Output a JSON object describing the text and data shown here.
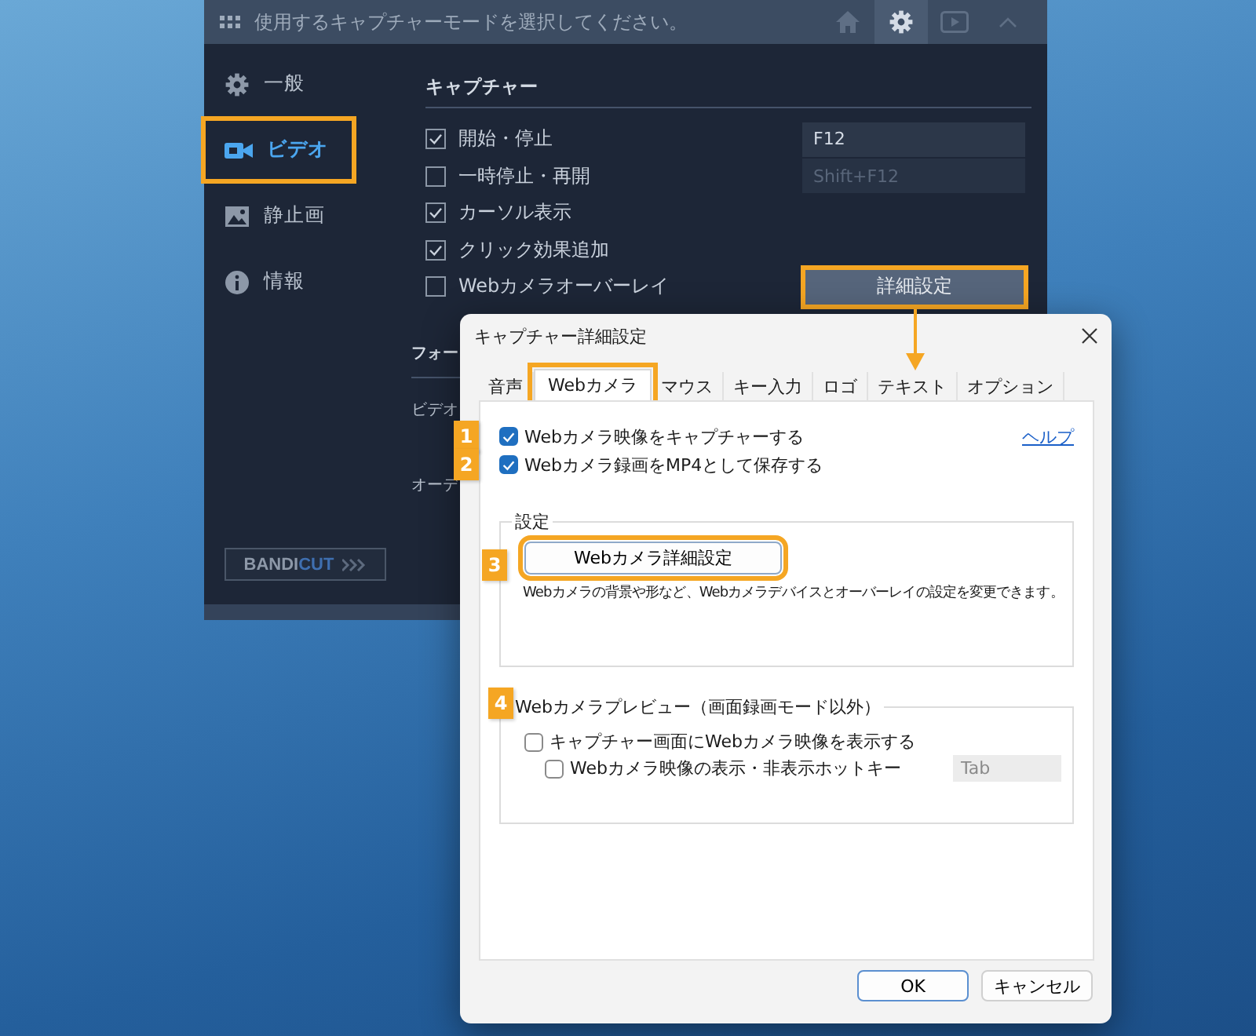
{
  "main_window": {
    "header_text": "使用するキャプチャーモードを選択してください。",
    "toolbar": [
      {
        "kind": "home",
        "selected": false
      },
      {
        "kind": "settings",
        "selected": true
      },
      {
        "kind": "video",
        "selected": false
      },
      {
        "kind": "collapse",
        "selected": false
      }
    ],
    "sidebar": {
      "items": [
        {
          "label": "一般",
          "kind": "gear",
          "selected": false,
          "highlighted": false
        },
        {
          "label": "ビデオ",
          "kind": "camera",
          "selected": true,
          "highlighted": true
        },
        {
          "label": "静止画",
          "kind": "image",
          "selected": false,
          "highlighted": false
        },
        {
          "label": "情報",
          "kind": "info",
          "selected": false,
          "highlighted": false
        }
      ]
    },
    "capture": {
      "heading": "キャプチャー",
      "options": [
        {
          "label": "開始・停止",
          "checked": true,
          "hotkey": "F12",
          "hotkey_disabled": false
        },
        {
          "label": "一時停止・再開",
          "checked": false,
          "hotkey": "Shift+F12",
          "hotkey_disabled": true
        },
        {
          "label": "カーソル表示",
          "checked": true
        },
        {
          "label": "クリック効果追加",
          "checked": true
        },
        {
          "label": "Webカメラオーバーレイ",
          "checked": false
        }
      ],
      "button": {
        "label": "詳細設定",
        "highlighted": true
      }
    },
    "section_2": {
      "heading": "フォー",
      "rows": [
        "ビデオ",
        "オーデ"
      ]
    },
    "bandicut_button": {
      "text": "BANDI",
      "accent_text": "CUT"
    }
  },
  "dialog": {
    "title": "キャプチャー詳細設定",
    "tabs": [
      {
        "label": "音声",
        "selected": false,
        "highlighted": false
      },
      {
        "label": "Webカメラ",
        "selected": true,
        "highlighted": true
      },
      {
        "label": "マウス",
        "selected": false,
        "highlighted": false
      },
      {
        "label": "キー入力",
        "selected": false,
        "highlighted": false
      },
      {
        "label": "ロゴ",
        "selected": false,
        "highlighted": false
      },
      {
        "label": "テキスト",
        "selected": false,
        "highlighted": false
      },
      {
        "label": "オプション",
        "selected": false,
        "highlighted": false
      }
    ],
    "options": [
      {
        "badge": "1",
        "label": "Webカメラ映像をキャプチャーする",
        "checked": true
      },
      {
        "badge": "2",
        "label": "Webカメラ録画をMP4として保存する",
        "checked": true
      }
    ],
    "help_link": "ヘルプ",
    "settings_group": {
      "title": "設定",
      "badge": "3",
      "button": {
        "label": "Webカメラ詳細設定",
        "highlighted": true
      },
      "description": "Webカメラの背景や形など、Webカメラデバイスとオーバーレイの設定を変更できます。"
    },
    "preview_group": {
      "badge": "4",
      "title": "Webカメラプレビュー（画面録画モード以外）",
      "options": [
        {
          "label": "キャプチャー画面にWebカメラ映像を表示する",
          "checked": false,
          "children": [
            {
              "label": "Webカメラ映像の表示・非表示ホットキー",
              "checked": false,
              "hotkey": "Tab",
              "hotkey_disabled": true
            }
          ]
        }
      ]
    },
    "buttons": [
      {
        "label": "OK",
        "default": true
      },
      {
        "label": "キャンセル",
        "default": false
      }
    ]
  }
}
